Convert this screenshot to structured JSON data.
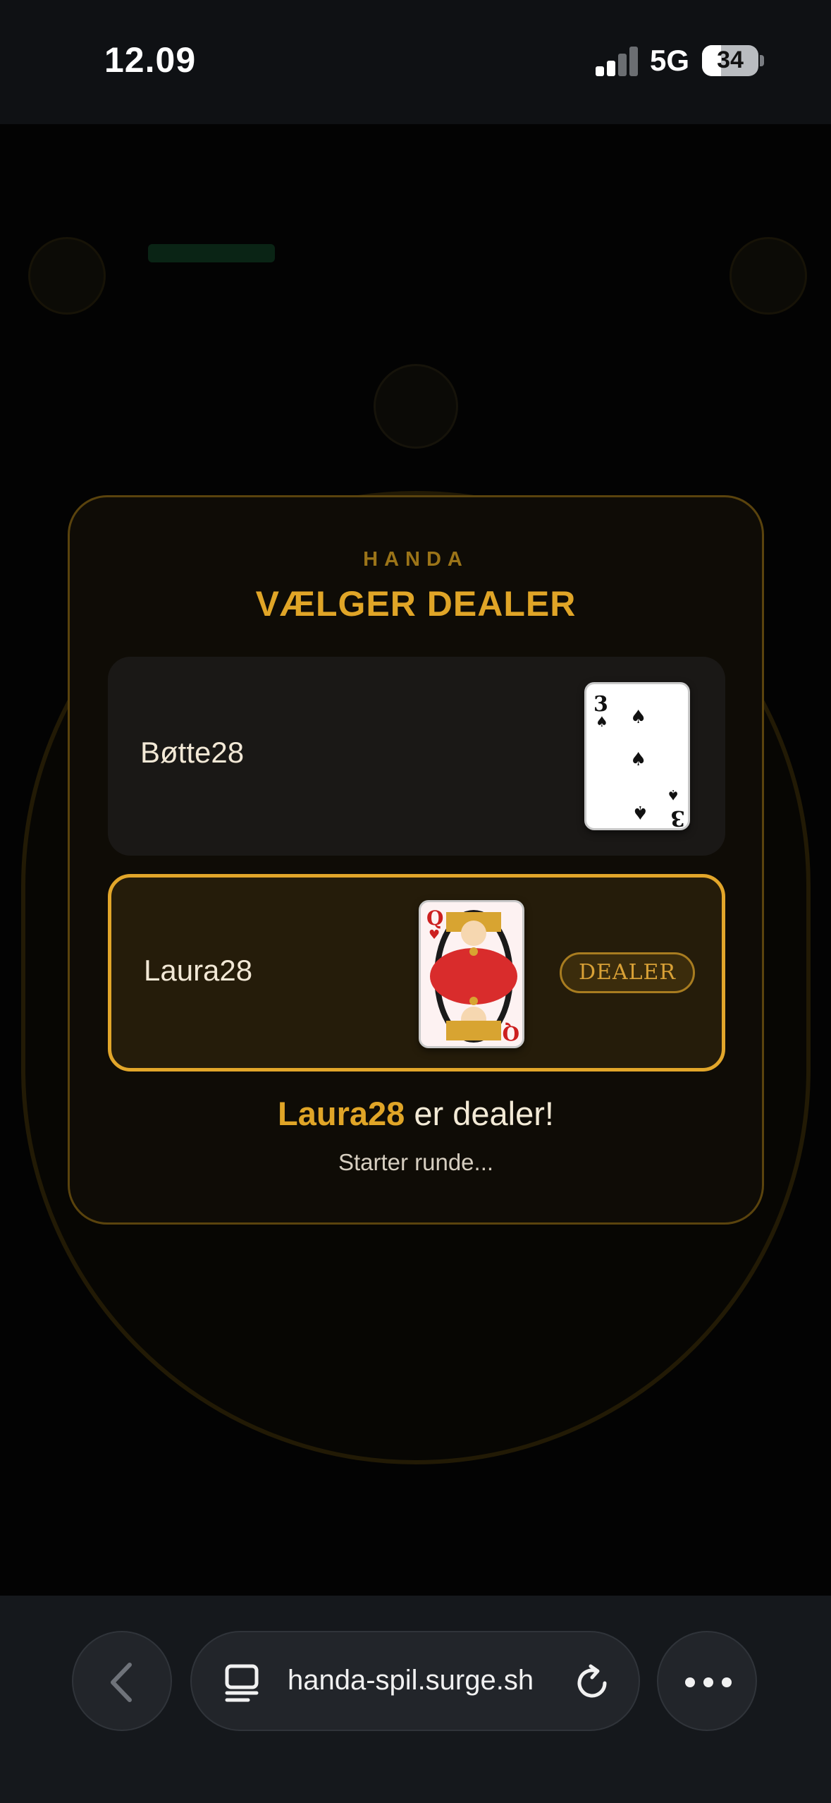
{
  "status_bar": {
    "time": "12.09",
    "network": "5G",
    "battery": "34",
    "battery_level": 0.34
  },
  "modal": {
    "eyebrow": "HANDA",
    "title": "VÆLGER DEALER",
    "players": [
      {
        "name": "Bøtte28",
        "card": {
          "rank": "3",
          "suit": "spades",
          "symbol": "♠",
          "color": "#111111"
        }
      },
      {
        "name": "Laura28",
        "card": {
          "rank": "Q",
          "suit": "hearts",
          "symbol": "♥",
          "color": "#cc1f1f"
        },
        "badge": "DEALER",
        "selected": true
      }
    ],
    "result_name": "Laura28",
    "result_text": " er dealer!",
    "subtitle": "Starter runde..."
  },
  "browser": {
    "url": "handa-spil.surge.sh",
    "icons": [
      "chevron-left-icon",
      "tabs-icon",
      "reload-icon",
      "more-icon"
    ]
  },
  "colors": {
    "accent": "#e0a527",
    "eyebrow": "#9b7418",
    "modal_bg": "#0f0c06",
    "selected_row_bg": "#251c0a"
  }
}
